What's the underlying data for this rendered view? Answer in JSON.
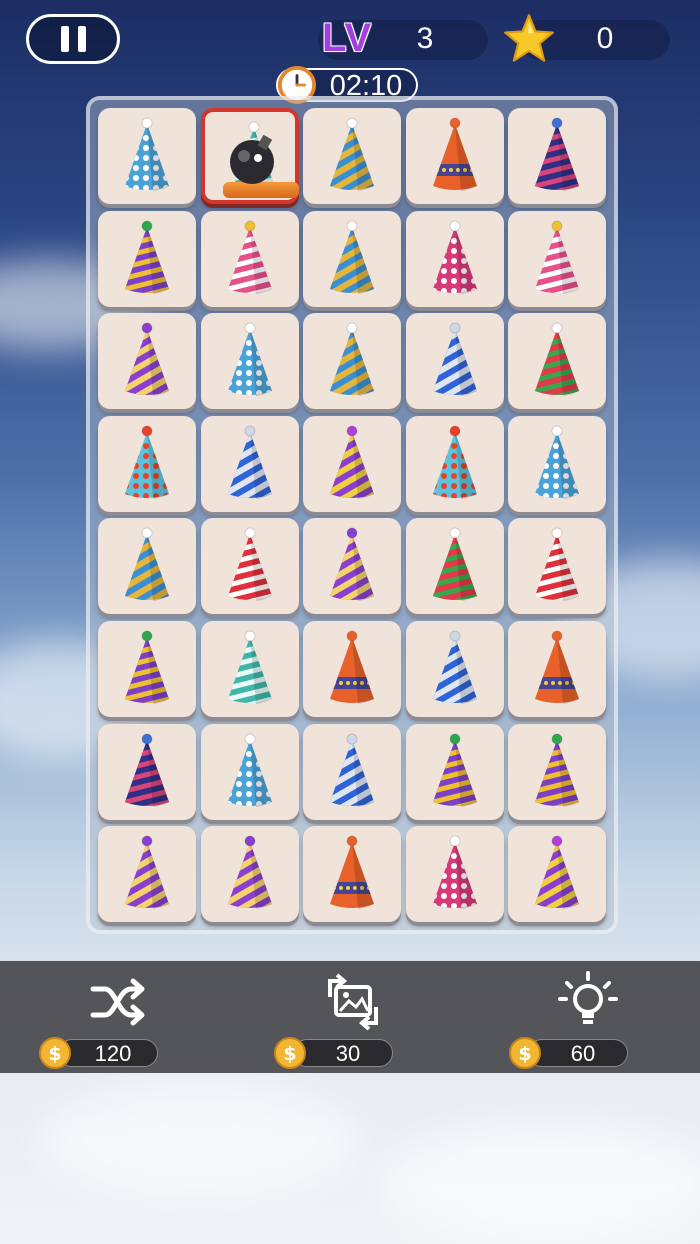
{
  "hud": {
    "level_label": "LV",
    "level_value": "3",
    "stars_value": "0",
    "timer": "02:10"
  },
  "board": {
    "rows": 8,
    "cols": 5,
    "selected": [
      0,
      1
    ],
    "tiles": [
      [
        "blue-dots",
        "teal-stripe",
        "rainbow-swirl",
        "birthday-orange",
        "navy-stripe"
      ],
      [
        "rainbow-ribbon",
        "pink-stripe",
        "rainbow-swirl",
        "pink-dots",
        "pink-stripe"
      ],
      [
        "purple-stripe",
        "blue-dots",
        "rainbow-swirl",
        "blue-silver",
        "red-green-stripe"
      ],
      [
        "colorful-dots",
        "blue-silver",
        "purple-gold",
        "colorful-dots",
        "blue-dots"
      ],
      [
        "rainbow-swirl",
        "red-white",
        "purple-stripe",
        "red-green-stripe",
        "red-white"
      ],
      [
        "rainbow-ribbon",
        "teal-stripe",
        "birthday-orange",
        "blue-silver",
        "birthday-orange"
      ],
      [
        "navy-stripe",
        "blue-dots",
        "blue-silver",
        "rainbow-ribbon",
        "rainbow-ribbon"
      ],
      [
        "purple-stripe",
        "purple-stripe",
        "birthday-orange",
        "pink-dots",
        "purple-gold"
      ]
    ]
  },
  "tools": [
    {
      "name": "shuffle",
      "icon": "shuffle-icon",
      "cost": "120"
    },
    {
      "name": "swap",
      "icon": "swap-image-icon",
      "cost": "30"
    },
    {
      "name": "hint",
      "icon": "lightbulb-icon",
      "cost": "60"
    }
  ],
  "hat_styles": {
    "blue-dots": {
      "base": "#4aa3d8",
      "accent": "#ffffff",
      "pattern": "dots",
      "pom": "#ffffff"
    },
    "teal-stripe": {
      "base": "#3fb6a8",
      "accent": "#e8fbf8",
      "pattern": "stripes",
      "pom": "#ffffff"
    },
    "rainbow-swirl": {
      "base": "#e5b63c",
      "accent": "#3a8fd4",
      "pattern": "swirl",
      "pom": "#ffffff"
    },
    "birthday-orange": {
      "base": "#e8612a",
      "accent": "#2a3fa8",
      "pattern": "text",
      "pom": "#e8612a"
    },
    "navy-stripe": {
      "base": "#2f2f85",
      "accent": "#d8457a",
      "pattern": "stripes",
      "pom": "#3a6fd8"
    },
    "rainbow-ribbon": {
      "base": "#7b3fc8",
      "accent": "#f0c030",
      "pattern": "bands",
      "pom": "#2aa84a"
    },
    "pink-stripe": {
      "base": "#e8508a",
      "accent": "#ffffff",
      "pattern": "stripes",
      "pom": "#f0c030"
    },
    "pink-dots": {
      "base": "#d83a78",
      "accent": "#ffffff",
      "pattern": "dots",
      "pom": "#ffffff"
    },
    "purple-stripe": {
      "base": "#8a3fd0",
      "accent": "#f3d36a",
      "pattern": "diag",
      "pom": "#8a3fd0"
    },
    "blue-silver": {
      "base": "#2f63d8",
      "accent": "#e0e6f0",
      "pattern": "swirl",
      "pom": "#cfd8e6"
    },
    "red-green-stripe": {
      "base": "#e23a4a",
      "accent": "#3aa84a",
      "pattern": "stripes",
      "pom": "#ffffff"
    },
    "colorful-dots": {
      "base": "#5ec3dc",
      "accent": "#e8402a",
      "pattern": "dots",
      "pom": "#e8402a"
    },
    "purple-gold": {
      "base": "#8a3fd0",
      "accent": "#f0d040",
      "pattern": "diag",
      "pom": "#b040d8"
    },
    "red-white": {
      "base": "#e0303a",
      "accent": "#ffffff",
      "pattern": "stripes",
      "pom": "#ffffff"
    }
  }
}
